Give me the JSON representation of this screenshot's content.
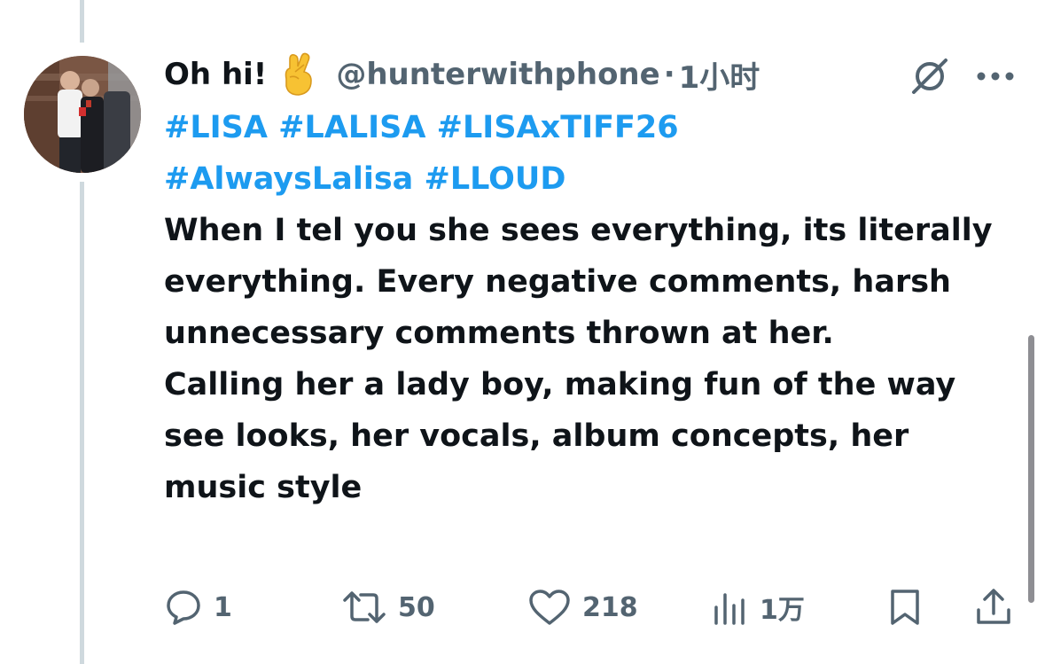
{
  "tweet": {
    "author_name": "Oh hi!",
    "emoji_icon": "crossed-fingers-emoji",
    "handle": "@hunterwithphone",
    "separator": "·",
    "time": "1小时",
    "hashtags": [
      "#LISA",
      "#LALISA",
      "#LISAxTIFF26",
      "#AlwaysLalisa",
      "#LLOUD"
    ],
    "body_paragraph_1": "When I tel you she sees everything, its literally everything. Every negative comments, harsh unnecessary comments thrown at her.",
    "body_paragraph_2": "Calling her a lady boy, making fun of the way see looks, her vocals, album concepts, her music style"
  },
  "actions": {
    "replies": "1",
    "reposts": "50",
    "likes": "218",
    "views": "1万"
  },
  "colors": {
    "link": "#1d9bf0",
    "text": "#0f1419",
    "muted": "#536471",
    "thread_line": "#cfd9de"
  }
}
